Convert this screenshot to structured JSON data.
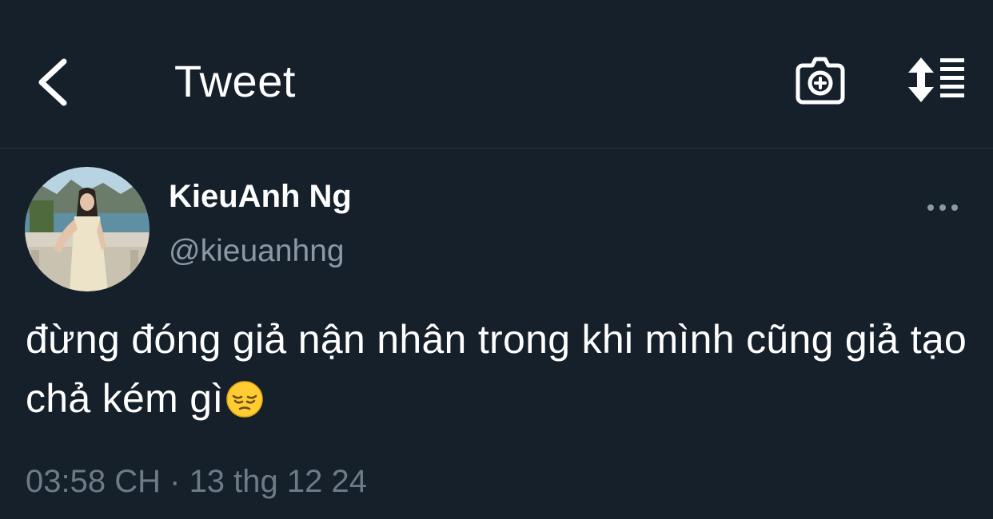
{
  "header": {
    "title": "Tweet"
  },
  "tweet": {
    "display_name": "KieuAnh Ng",
    "handle": "@kieuanhng",
    "text": "đừng đóng giả nận nhân trong khi mình cũng giả tạo chả kém gì",
    "emoji": "pensive-face",
    "time": "03:58 CH",
    "separator": "·",
    "date": "13 thg 12 24"
  },
  "icons": {
    "back": "chevron-left-icon",
    "camera": "camera-plus-icon",
    "sort": "sort-icon",
    "more": "more-horizontal-icon"
  },
  "colors": {
    "background": "#15202b",
    "text_primary": "#ffffff",
    "text_secondary": "#8b98a5",
    "divider": "#2b3640"
  }
}
